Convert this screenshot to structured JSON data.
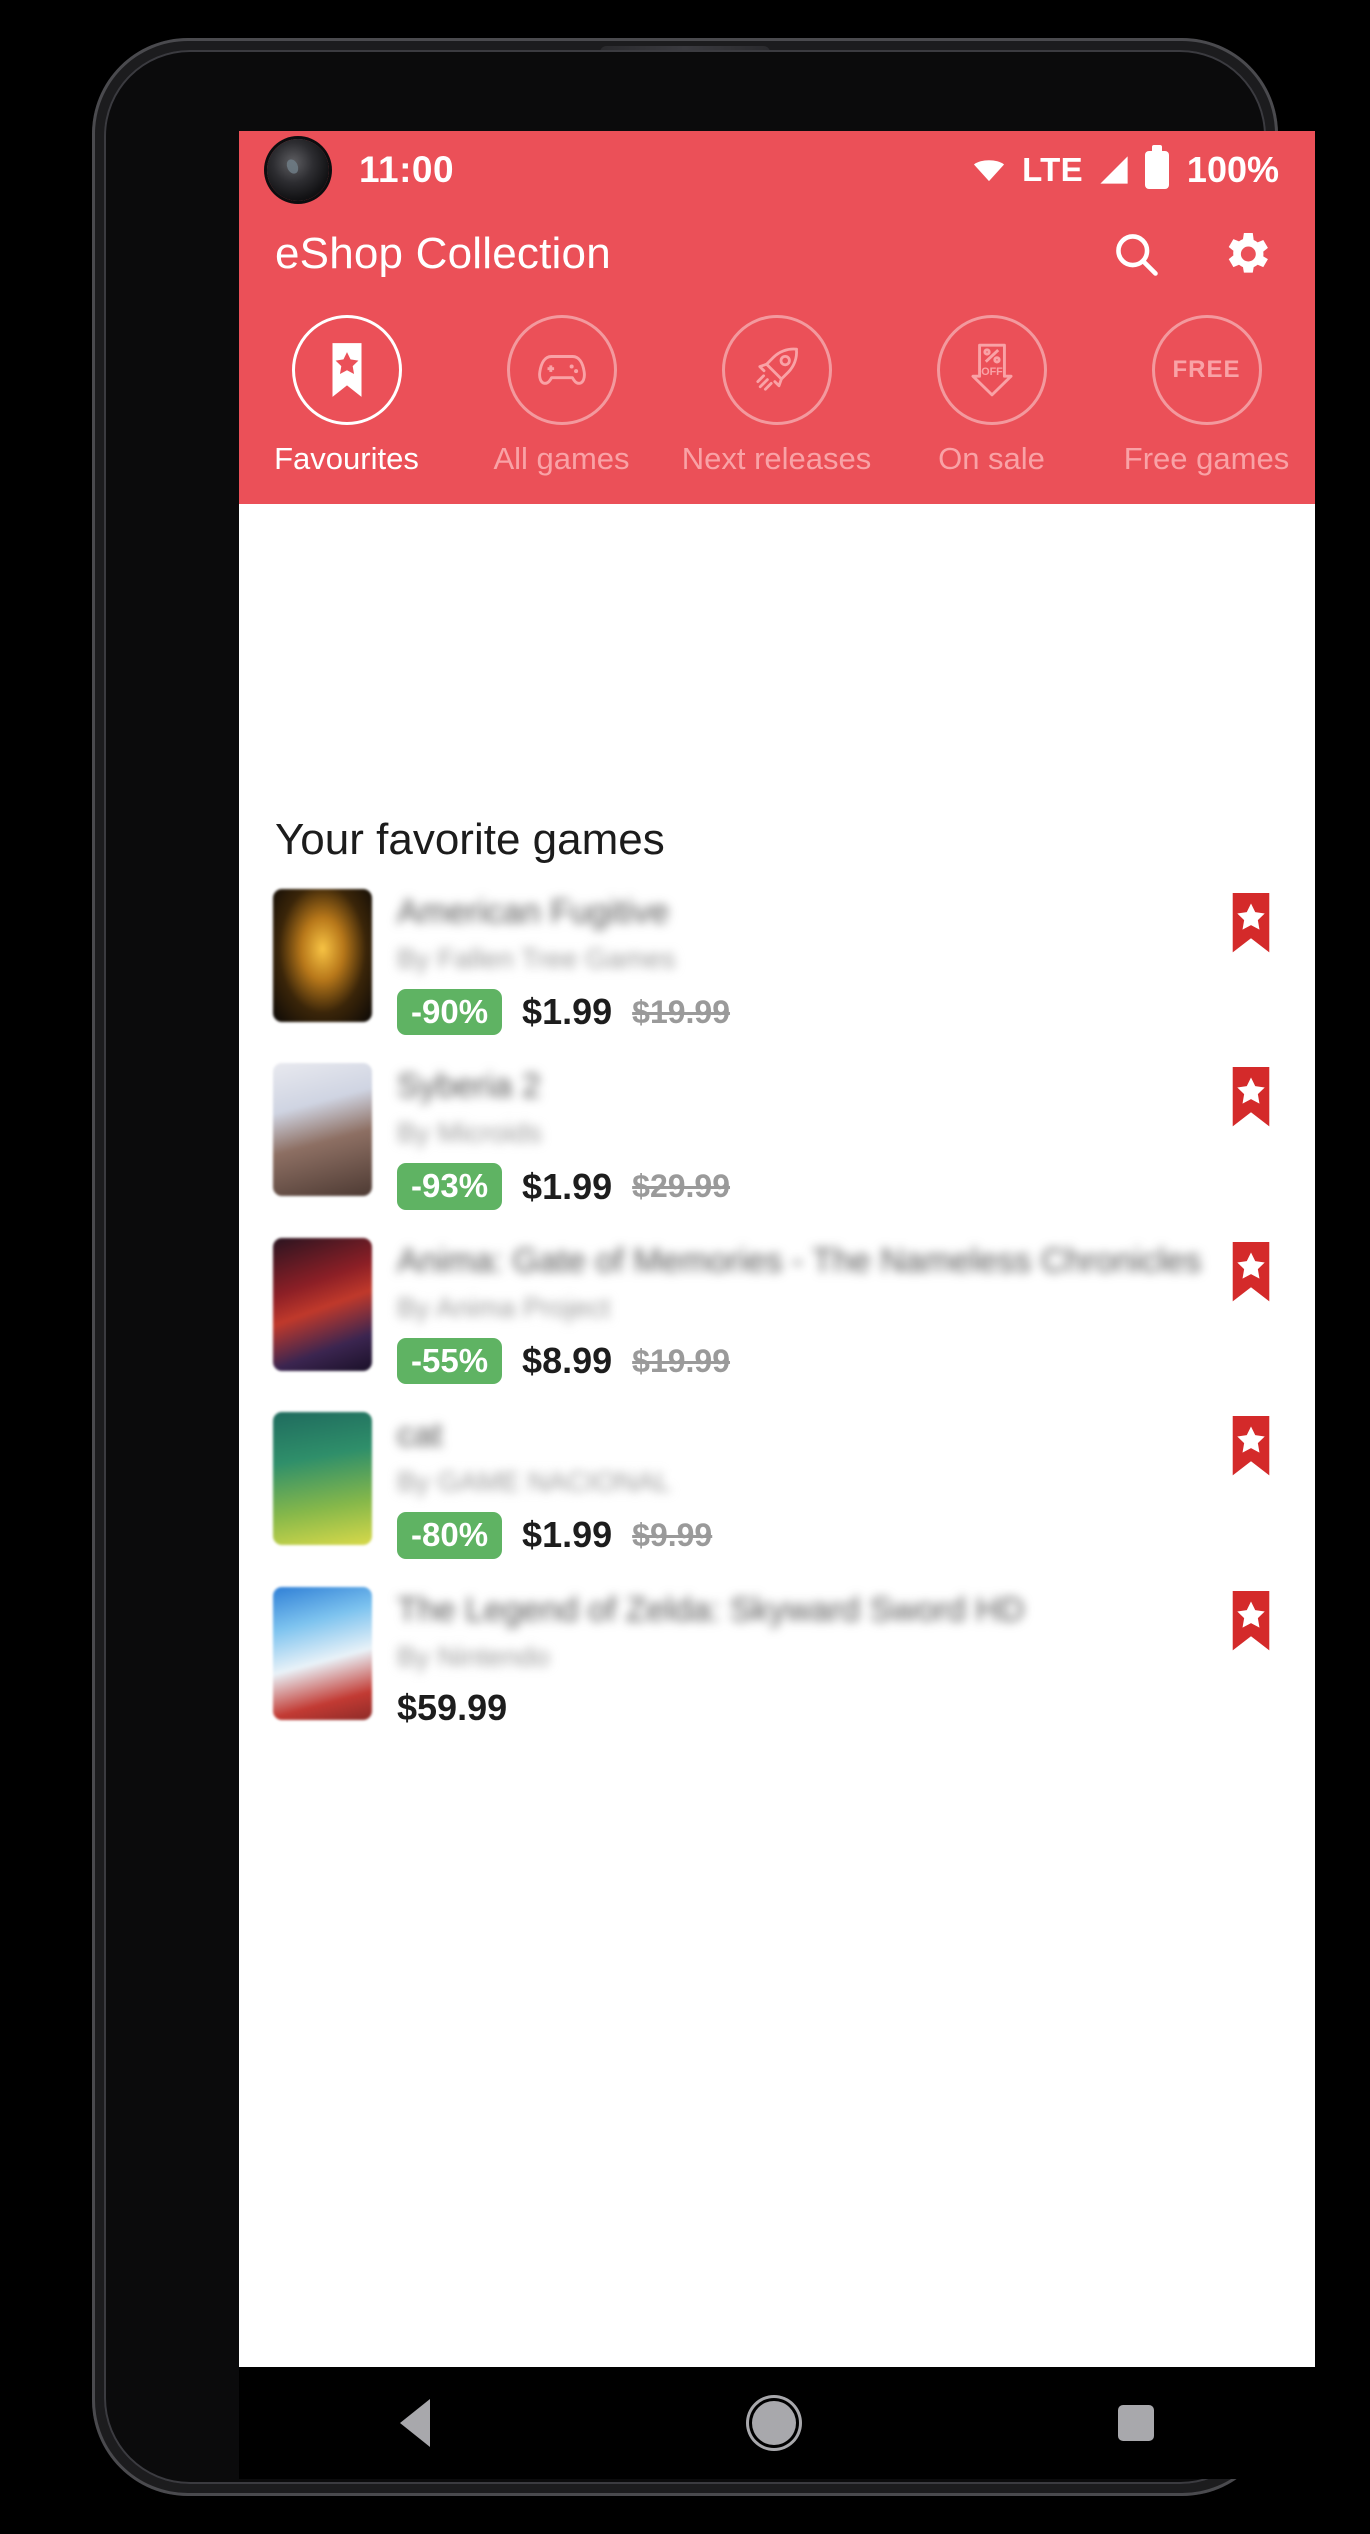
{
  "statusbar": {
    "time": "11:00",
    "network": "LTE",
    "battery": "100%",
    "icons": [
      "wifi-icon",
      "signal-icon",
      "battery-icon"
    ]
  },
  "appbar": {
    "title": "eShop Collection",
    "accent": "#EB5058",
    "actions": [
      {
        "name": "search-icon",
        "label": "Search"
      },
      {
        "name": "gear-icon",
        "label": "Settings"
      }
    ]
  },
  "categories": [
    {
      "label": "Favourites",
      "icon": "bookmark-star-icon",
      "active": true
    },
    {
      "label": "All games",
      "icon": "gamepad-icon",
      "active": false
    },
    {
      "label": "Next releases",
      "icon": "rocket-icon",
      "active": false
    },
    {
      "label": "On sale",
      "icon": "percent-off-tag-icon",
      "active": false
    },
    {
      "label": "Free games",
      "icon": "free-badge-icon",
      "active": false
    }
  ],
  "content": {
    "heading": "Your favorite games",
    "games": [
      {
        "title": "American Fugitive",
        "developer": "By Fallen Tree Games",
        "discount": "-90%",
        "price": "$1.99",
        "old_price": "$19.99",
        "favorited": true,
        "cover": "c1"
      },
      {
        "title": "Syberia 2",
        "developer": "By Microids",
        "discount": "-93%",
        "price": "$1.99",
        "old_price": "$29.99",
        "favorited": true,
        "cover": "c2"
      },
      {
        "title": "Anima: Gate of Memories - The Nameless Chronicles",
        "developer": "By Anima Project",
        "discount": "-55%",
        "price": "$8.99",
        "old_price": "$19.99",
        "favorited": true,
        "cover": "c3"
      },
      {
        "title": "cat",
        "developer": "By GAME NACIONAL",
        "discount": "-80%",
        "price": "$1.99",
        "old_price": "$9.99",
        "favorited": true,
        "cover": "c4"
      },
      {
        "title": "The Legend of Zelda: Skyward Sword HD",
        "developer": "By Nintendo",
        "discount": "",
        "price": "$59.99",
        "old_price": "",
        "favorited": true,
        "cover": "c5"
      }
    ]
  },
  "navbar": {
    "back": "back-button",
    "home": "home-button",
    "recents": "recents-button"
  },
  "colors": {
    "accent": "#EB5058",
    "discount_green": "#5FB363",
    "favorite_red": "#D42A2A"
  }
}
